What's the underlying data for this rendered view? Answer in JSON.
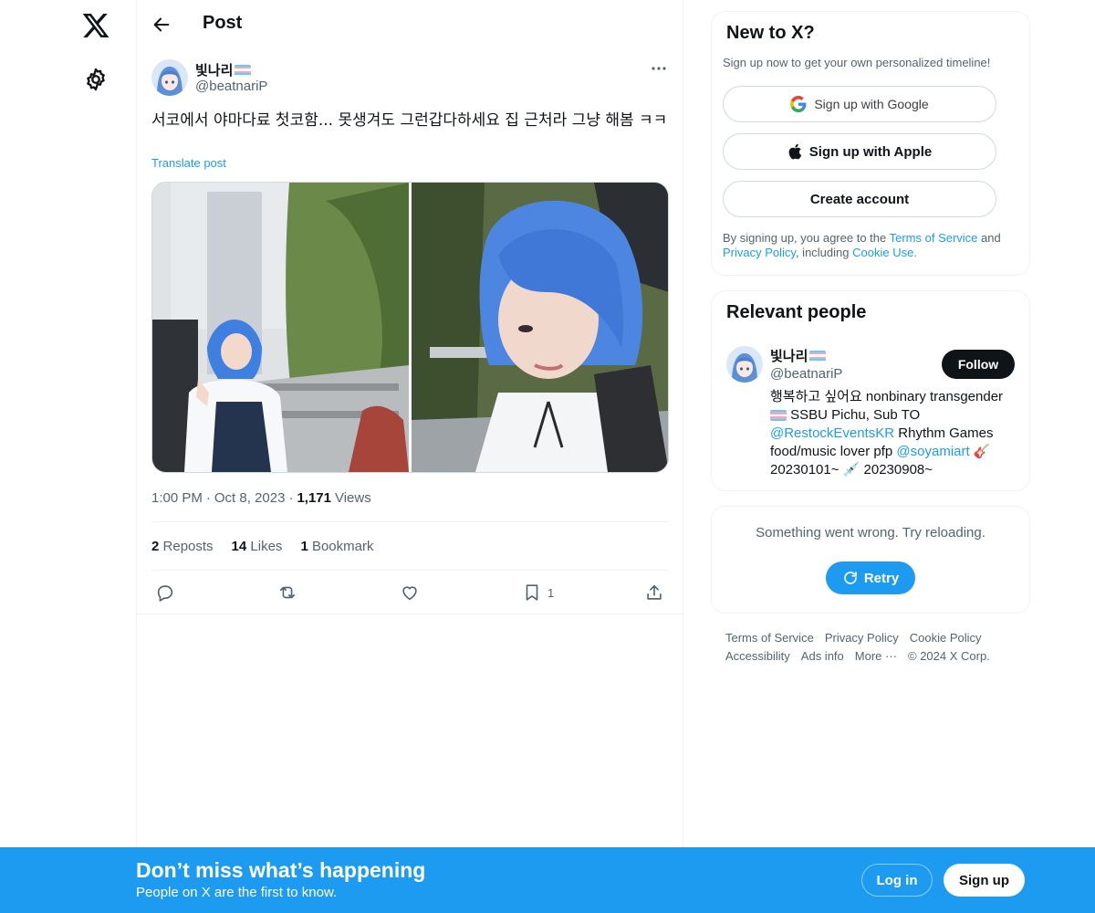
{
  "nav": {
    "logo_icon": "x-logo-icon",
    "settings_icon": "gear-icon"
  },
  "header": {
    "back_icon": "arrow-left-icon",
    "title": "Post"
  },
  "post": {
    "author_name": "빛나리",
    "author_handle": "@beatnariP",
    "flag_icon": "transgender-flag-icon",
    "more_icon": "ellipsis-icon",
    "text": "서코에서 야마다료 첫코함... 못생겨도 그런갑다하세요 집 근처라 그냥 해봄 ㅋㅋ",
    "translate_label": "Translate post",
    "time": "1:00 PM",
    "date": "Oct 8, 2023",
    "views_count": "1,171",
    "views_label": "Views",
    "reposts_count": "2",
    "reposts_label": "Reposts",
    "likes_count": "14",
    "likes_label": "Likes",
    "bookmarks_count": "1",
    "bookmarks_label": "Bookmark",
    "bookmark_action_count": "1"
  },
  "signup_card": {
    "title": "New to X?",
    "subtitle": "Sign up now to get your own personalized timeline!",
    "google_label": "Sign up with Google",
    "apple_label": "Sign up with Apple",
    "create_label": "Create account",
    "legal_prefix": "By signing up, you agree to the ",
    "terms_link": "Terms of Service",
    "legal_and": " and ",
    "privacy_link": "Privacy Policy",
    "legal_including": ", including ",
    "cookie_link": "Cookie Use."
  },
  "relevant_people": {
    "title": "Relevant people",
    "name": "빛나리",
    "handle": "@beatnariP",
    "follow_label": "Follow",
    "bio_part1": "행복하고 싶어요 nonbinary transgender",
    "bio_part2": " SSBU Pichu, Sub TO ",
    "bio_mention1": "@RestockEventsKR",
    "bio_part3": " Rhythm Games food/music lover pfp ",
    "bio_mention2": "@soyamiart",
    "bio_part4": " 🎸 20230101~ 💉 20230908~"
  },
  "error_card": {
    "message": "Something went wrong. Try reloading.",
    "retry_label": "Retry"
  },
  "footer": {
    "links": [
      "Terms of Service",
      "Privacy Policy",
      "Cookie Policy",
      "Accessibility",
      "Ads info",
      "More ···",
      "© 2024 X Corp."
    ]
  },
  "banner": {
    "title": "Don’t miss what’s happening",
    "subtitle": "People on X are the first to know.",
    "login_label": "Log in",
    "signup_label": "Sign up"
  },
  "colors": {
    "accent": "#1d9bf0",
    "text": "#0f1419",
    "muted": "#536471",
    "border": "#eff3f4",
    "flag_blue": "#5bcefa",
    "flag_pink": "#f5a9b8"
  }
}
